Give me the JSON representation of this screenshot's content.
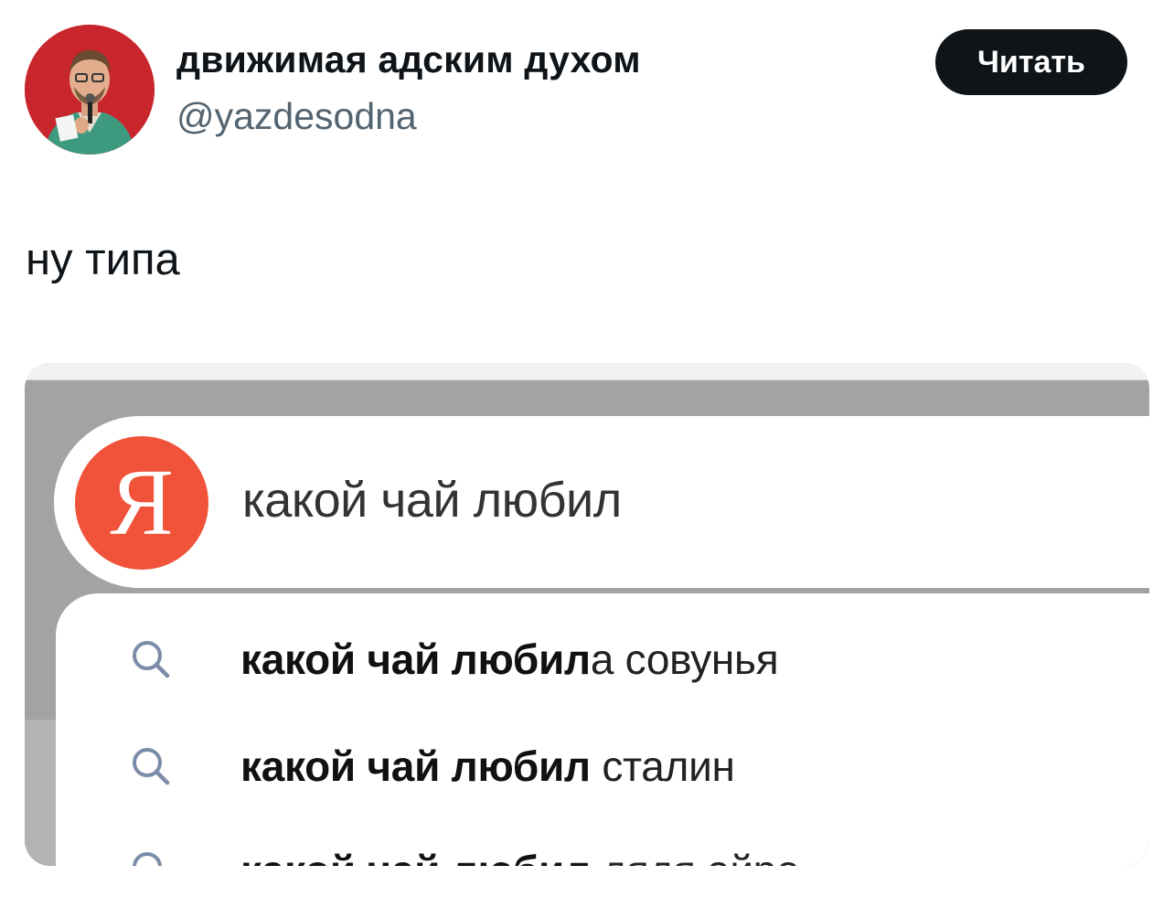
{
  "author": {
    "display_name": "движимая адским духом",
    "handle": "@yazdesodna"
  },
  "follow_button": {
    "label": "Читать"
  },
  "tweet": {
    "text": "ну типа"
  },
  "screenshot": {
    "logo_letter": "Я",
    "search_query": "какой чай любил",
    "suggestions": [
      {
        "bold": "какой чай любил",
        "rest": "а совунья"
      },
      {
        "bold": "какой чай любил",
        "rest": " сталин"
      },
      {
        "bold": "какой чай любил",
        "rest": " дядя айро"
      }
    ],
    "colors": {
      "logo": "#f0533a",
      "follow_bg": "#0f1419",
      "handle": "#536471"
    },
    "icon": "search-icon"
  }
}
